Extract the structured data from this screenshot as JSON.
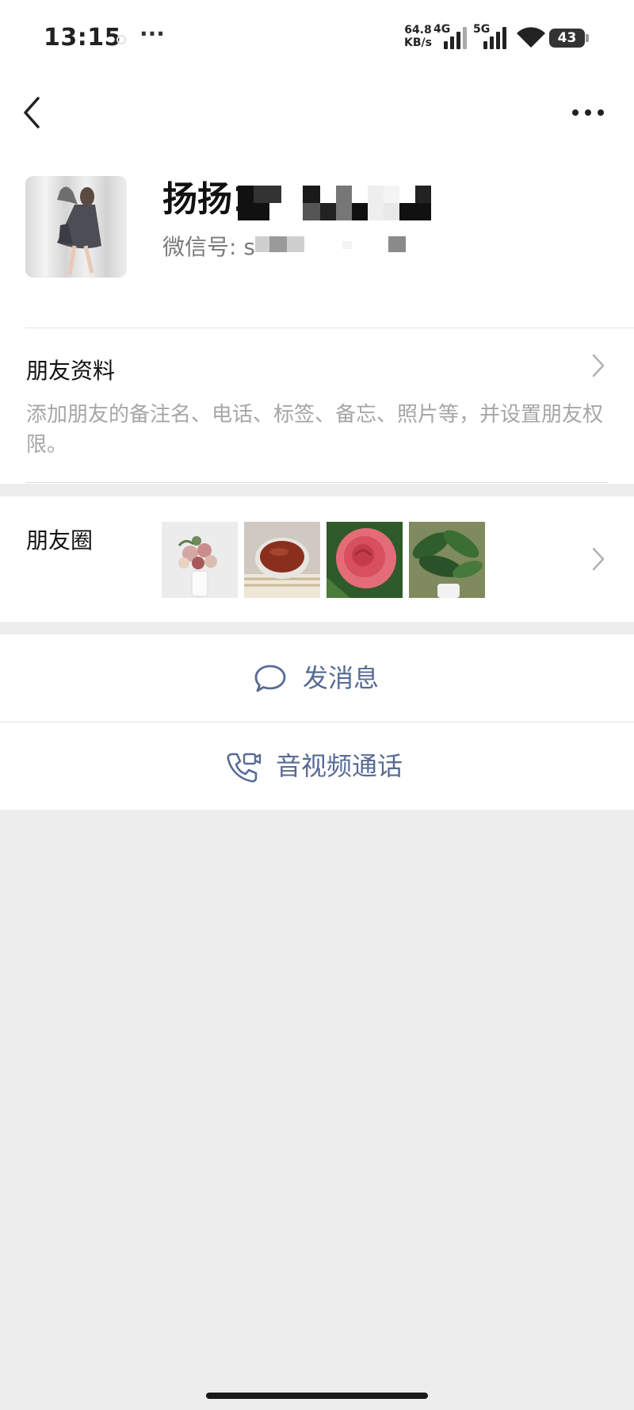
{
  "status_bar": {
    "time": "13:15",
    "more": "···",
    "net_speed_value": "64.8",
    "net_speed_unit": "KB/s",
    "network_1": "4G",
    "network_2": "5G",
    "battery": "43"
  },
  "profile": {
    "name_visible": "扬扬1",
    "wechat_id_label": "微信号: s"
  },
  "friend_info": {
    "title": "朋友资料",
    "description": "添加朋友的备注名、电话、标签、备忘、照片等，并设置朋友权限。"
  },
  "moments": {
    "title": "朋友圈",
    "thumbnails": [
      "flower-bouquet",
      "tea-cup",
      "pink-rose",
      "potted-plant"
    ]
  },
  "actions": {
    "send_message": "发消息",
    "video_call": "音视频通话"
  },
  "colors": {
    "accent_text": "#576b95",
    "background": "#ededed"
  }
}
